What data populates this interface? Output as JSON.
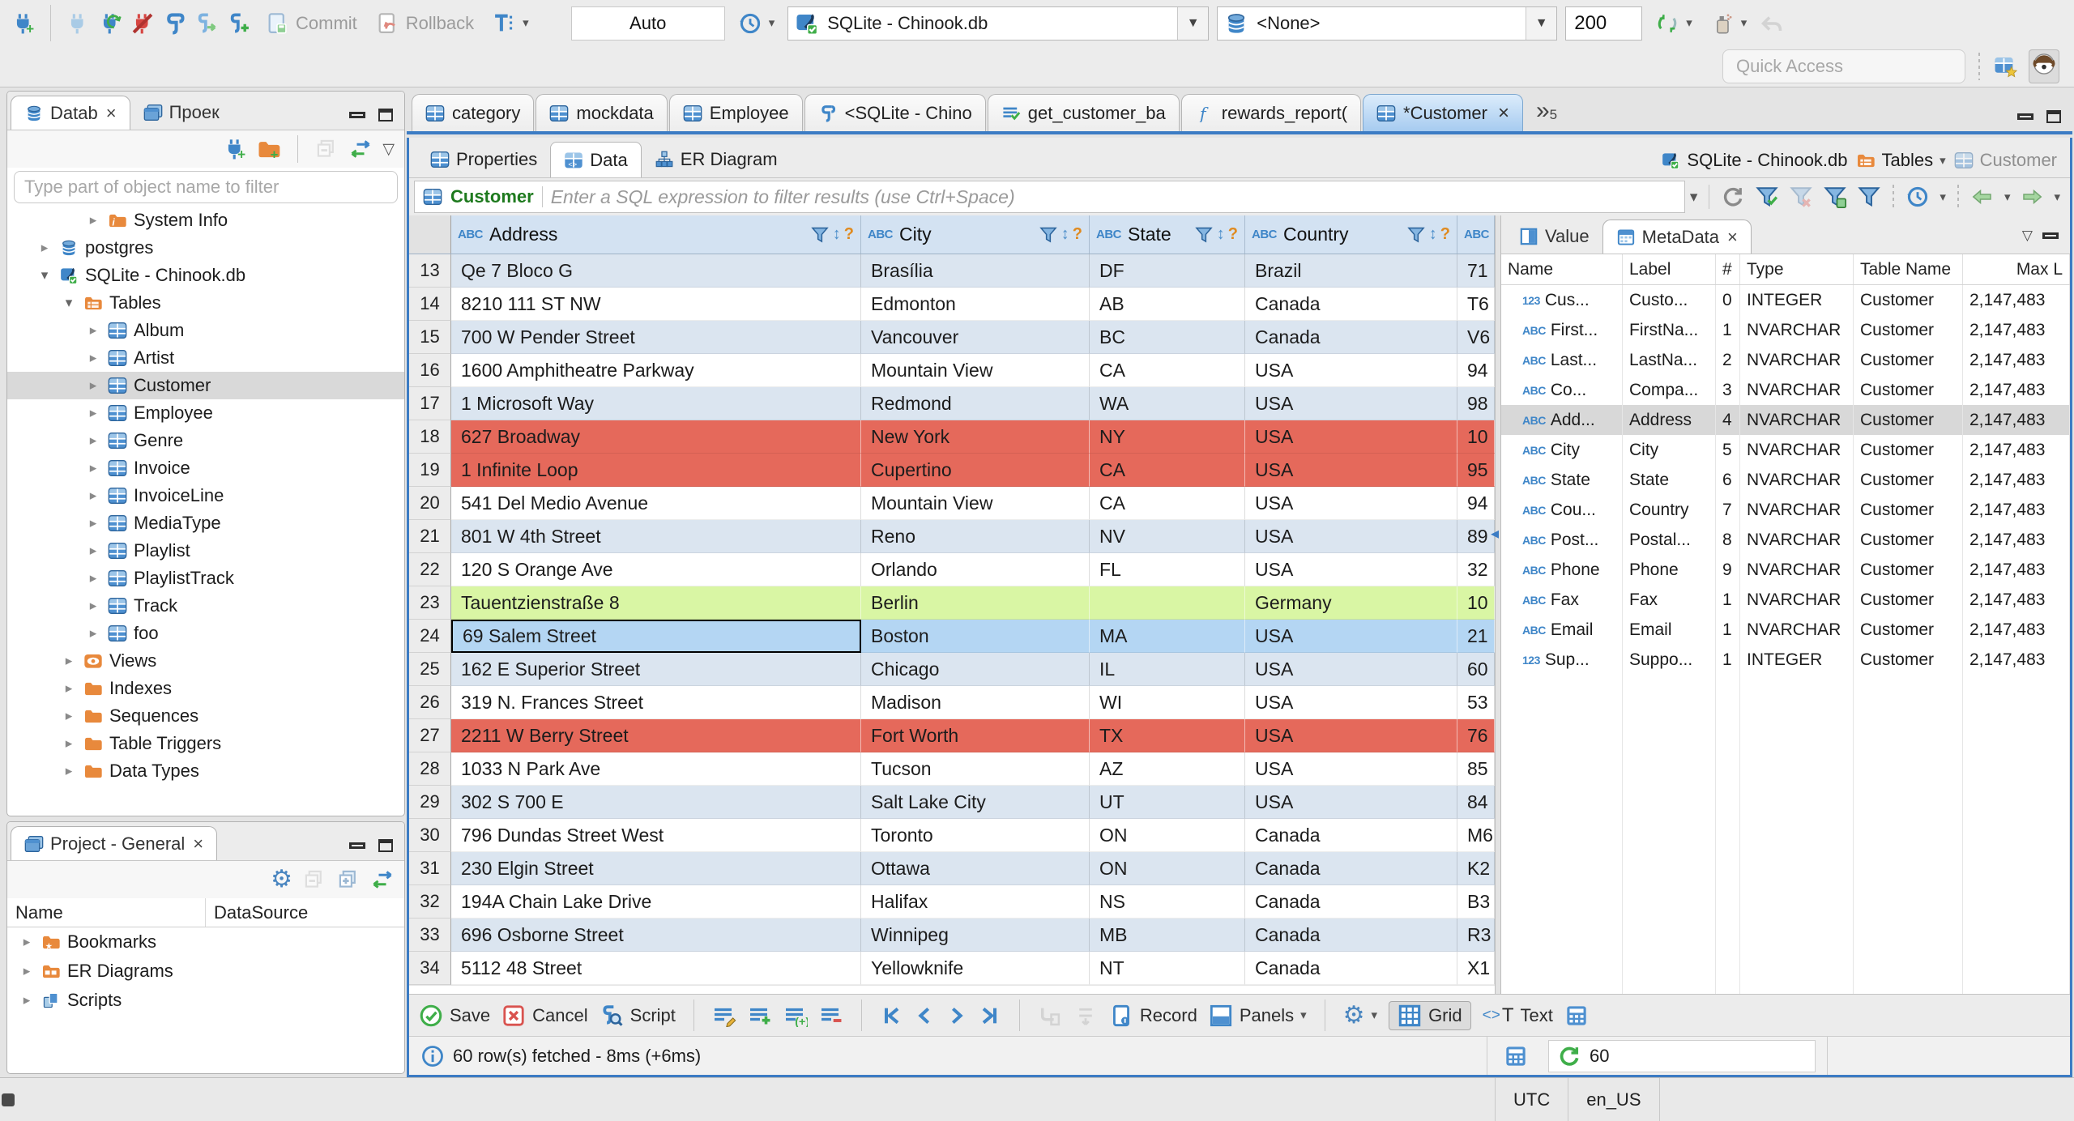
{
  "topbar": {
    "commit": "Commit",
    "rollback": "Rollback",
    "auto": "Auto",
    "db_combo": "SQLite - Chinook.db",
    "schema_combo": "<None>",
    "fetch_size": "200",
    "quick_access": "Quick Access"
  },
  "nav": {
    "tab_database": "Datab",
    "tab_project": "Проек",
    "filter_placeholder": "Type part of object name to filter",
    "tree": [
      {
        "label": "System Info",
        "icon": "foldInfo",
        "arrow": "r",
        "lvl": 3
      },
      {
        "label": "postgres",
        "icon": "dbCyl",
        "arrow": "r",
        "lvl": 1
      },
      {
        "label": "SQLite - Chinook.db",
        "icon": "sqliteIc",
        "arrow": "d",
        "lvl": 1
      },
      {
        "label": "Tables",
        "icon": "foldTbl",
        "arrow": "d",
        "lvl": 2
      },
      {
        "label": "Album",
        "icon": "tbl",
        "arrow": "r",
        "lvl": 3
      },
      {
        "label": "Artist",
        "icon": "tbl",
        "arrow": "r",
        "lvl": 3
      },
      {
        "label": "Customer",
        "icon": "tbl",
        "arrow": "r",
        "lvl": 3,
        "selected": true
      },
      {
        "label": "Employee",
        "icon": "tbl",
        "arrow": "r",
        "lvl": 3
      },
      {
        "label": "Genre",
        "icon": "tbl",
        "arrow": "r",
        "lvl": 3
      },
      {
        "label": "Invoice",
        "icon": "tbl",
        "arrow": "r",
        "lvl": 3
      },
      {
        "label": "InvoiceLine",
        "icon": "tbl",
        "arrow": "r",
        "lvl": 3
      },
      {
        "label": "MediaType",
        "icon": "tbl",
        "arrow": "r",
        "lvl": 3
      },
      {
        "label": "Playlist",
        "icon": "tbl",
        "arrow": "r",
        "lvl": 3
      },
      {
        "label": "PlaylistTrack",
        "icon": "tbl",
        "arrow": "r",
        "lvl": 3
      },
      {
        "label": "Track",
        "icon": "tbl",
        "arrow": "r",
        "lvl": 3
      },
      {
        "label": "foo",
        "icon": "tbl",
        "arrow": "r",
        "lvl": 3
      },
      {
        "label": "Views",
        "icon": "eye",
        "arrow": "r",
        "lvl": 2
      },
      {
        "label": "Indexes",
        "icon": "fold",
        "arrow": "r",
        "lvl": 2
      },
      {
        "label": "Sequences",
        "icon": "fold",
        "arrow": "r",
        "lvl": 2
      },
      {
        "label": "Table Triggers",
        "icon": "fold",
        "arrow": "r",
        "lvl": 2
      },
      {
        "label": "Data Types",
        "icon": "fold",
        "arrow": "r",
        "lvl": 2
      }
    ]
  },
  "project": {
    "title": "Project - General",
    "col_name": "Name",
    "col_datasource": "DataSource",
    "rows": [
      {
        "label": "Bookmarks",
        "icon": "foldStar"
      },
      {
        "label": "ER Diagrams",
        "icon": "foldEr"
      },
      {
        "label": "Scripts",
        "icon": "scriptsIc"
      }
    ]
  },
  "editor": {
    "tabs": [
      {
        "label": "category",
        "icon": "tbl"
      },
      {
        "label": "mockdata",
        "icon": "tbl"
      },
      {
        "label": "Employee",
        "icon": "tbl"
      },
      {
        "label": "<SQLite - Chino",
        "icon": "scroll"
      },
      {
        "label": "get_customer_ba",
        "icon": "sqlExec"
      },
      {
        "label": "rewards_report(",
        "icon": "fnF"
      },
      {
        "label": "*Customer",
        "icon": "tbl",
        "active": true,
        "close": true
      }
    ],
    "more_count": "5",
    "subtabs": [
      {
        "label": "Properties",
        "icon": "tbl"
      },
      {
        "label": "Data",
        "icon": "tblData",
        "active": true
      },
      {
        "label": "ER Diagram",
        "icon": "erIc"
      }
    ],
    "breadcrumb": {
      "db": "SQLite - Chinook.db",
      "tables": "Tables",
      "table": "Customer"
    }
  },
  "filter": {
    "table": "Customer",
    "placeholder": "Enter a SQL expression to filter results (use Ctrl+Space)"
  },
  "grid": {
    "columns": [
      "Address",
      "City",
      "State",
      "Country"
    ],
    "rows": [
      {
        "n": "13",
        "t": "alt",
        "c": [
          "Qe 7 Bloco G",
          "Brasília",
          "DF",
          "Brazil",
          "71"
        ]
      },
      {
        "n": "14",
        "t": "white",
        "c": [
          "8210 111 ST NW",
          "Edmonton",
          "AB",
          "Canada",
          "T6"
        ]
      },
      {
        "n": "15",
        "t": "alt",
        "c": [
          "700 W Pender Street",
          "Vancouver",
          "BC",
          "Canada",
          "V6"
        ]
      },
      {
        "n": "16",
        "t": "white",
        "c": [
          "1600 Amphitheatre Parkway",
          "Mountain View",
          "CA",
          "USA",
          "94"
        ]
      },
      {
        "n": "17",
        "t": "alt",
        "c": [
          "1 Microsoft Way",
          "Redmond",
          "WA",
          "USA",
          "98"
        ]
      },
      {
        "n": "18",
        "t": "red",
        "c": [
          "627 Broadway",
          "New York",
          "NY",
          "USA",
          "10"
        ]
      },
      {
        "n": "19",
        "t": "red",
        "c": [
          "1 Infinite Loop",
          "Cupertino",
          "CA",
          "USA",
          "95"
        ]
      },
      {
        "n": "20",
        "t": "white",
        "c": [
          "541 Del Medio Avenue",
          "Mountain View",
          "CA",
          "USA",
          "94"
        ]
      },
      {
        "n": "21",
        "t": "alt",
        "c": [
          "801 W 4th Street",
          "Reno",
          "NV",
          "USA",
          "89"
        ]
      },
      {
        "n": "22",
        "t": "white",
        "c": [
          "120 S Orange Ave",
          "Orlando",
          "FL",
          "USA",
          "32"
        ]
      },
      {
        "n": "23",
        "t": "green",
        "c": [
          "Tauentzienstraße 8",
          "Berlin",
          "",
          "Germany",
          "10"
        ]
      },
      {
        "n": "24",
        "t": "sel",
        "c": [
          "69 Salem Street",
          "Boston",
          "MA",
          "USA",
          "21"
        ]
      },
      {
        "n": "25",
        "t": "alt",
        "c": [
          "162 E Superior Street",
          "Chicago",
          "IL",
          "USA",
          "60"
        ]
      },
      {
        "n": "26",
        "t": "white",
        "c": [
          "319 N. Frances Street",
          "Madison",
          "WI",
          "USA",
          "53"
        ]
      },
      {
        "n": "27",
        "t": "red",
        "c": [
          "2211 W Berry Street",
          "Fort Worth",
          "TX",
          "USA",
          "76"
        ]
      },
      {
        "n": "28",
        "t": "white",
        "c": [
          "1033 N Park Ave",
          "Tucson",
          "AZ",
          "USA",
          "85"
        ]
      },
      {
        "n": "29",
        "t": "alt",
        "c": [
          "302 S 700 E",
          "Salt Lake City",
          "UT",
          "USA",
          "84"
        ]
      },
      {
        "n": "30",
        "t": "white",
        "c": [
          "796 Dundas Street West",
          "Toronto",
          "ON",
          "Canada",
          "M6"
        ]
      },
      {
        "n": "31",
        "t": "alt",
        "c": [
          "230 Elgin Street",
          "Ottawa",
          "ON",
          "Canada",
          "K2"
        ]
      },
      {
        "n": "32",
        "t": "white",
        "c": [
          "194A Chain Lake Drive",
          "Halifax",
          "NS",
          "Canada",
          "B3"
        ]
      },
      {
        "n": "33",
        "t": "alt",
        "c": [
          "696 Osborne Street",
          "Winnipeg",
          "MB",
          "Canada",
          "R3"
        ]
      },
      {
        "n": "34",
        "t": "white",
        "c": [
          "5112 48 Street",
          "Yellowknife",
          "NT",
          "Canada",
          "X1"
        ]
      }
    ]
  },
  "meta": {
    "tab_value": "Value",
    "tab_meta": "MetaData",
    "columns": [
      "Name",
      "Label",
      "#",
      "Type",
      "Table Name",
      "Max L"
    ],
    "rows": [
      {
        "i": "123",
        "n": "Cus...",
        "l": "Custo...",
        "h": "0",
        "ty": "INTEGER",
        "tb": "Customer",
        "m": "2,147,483"
      },
      {
        "i": "ABC",
        "n": "First...",
        "l": "FirstNa...",
        "h": "1",
        "ty": "NVARCHAR",
        "tb": "Customer",
        "m": "2,147,483"
      },
      {
        "i": "ABC",
        "n": "Last...",
        "l": "LastNa...",
        "h": "2",
        "ty": "NVARCHAR",
        "tb": "Customer",
        "m": "2,147,483"
      },
      {
        "i": "ABC",
        "n": "Co...",
        "l": "Compa...",
        "h": "3",
        "ty": "NVARCHAR",
        "tb": "Customer",
        "m": "2,147,483"
      },
      {
        "i": "ABC",
        "n": "Add...",
        "l": "Address",
        "h": "4",
        "ty": "NVARCHAR",
        "tb": "Customer",
        "m": "2,147,483",
        "sel": true
      },
      {
        "i": "ABC",
        "n": "City",
        "l": "City",
        "h": "5",
        "ty": "NVARCHAR",
        "tb": "Customer",
        "m": "2,147,483"
      },
      {
        "i": "ABC",
        "n": "State",
        "l": "State",
        "h": "6",
        "ty": "NVARCHAR",
        "tb": "Customer",
        "m": "2,147,483"
      },
      {
        "i": "ABC",
        "n": "Cou...",
        "l": "Country",
        "h": "7",
        "ty": "NVARCHAR",
        "tb": "Customer",
        "m": "2,147,483"
      },
      {
        "i": "ABC",
        "n": "Post...",
        "l": "Postal...",
        "h": "8",
        "ty": "NVARCHAR",
        "tb": "Customer",
        "m": "2,147,483"
      },
      {
        "i": "ABC",
        "n": "Phone",
        "l": "Phone",
        "h": "9",
        "ty": "NVARCHAR",
        "tb": "Customer",
        "m": "2,147,483"
      },
      {
        "i": "ABC",
        "n": "Fax",
        "l": "Fax",
        "h": "1",
        "ty": "NVARCHAR",
        "tb": "Customer",
        "m": "2,147,483"
      },
      {
        "i": "ABC",
        "n": "Email",
        "l": "Email",
        "h": "1",
        "ty": "NVARCHAR",
        "tb": "Customer",
        "m": "2,147,483"
      },
      {
        "i": "123",
        "n": "Sup...",
        "l": "Suppo...",
        "h": "1",
        "ty": "INTEGER",
        "tb": "Customer",
        "m": "2,147,483"
      }
    ]
  },
  "rtoolbar": {
    "save": "Save",
    "cancel": "Cancel",
    "script": "Script",
    "record": "Record",
    "panels": "Panels",
    "grid": "Grid",
    "text": "Text"
  },
  "status": {
    "message": "60 row(s) fetched - 8ms (+6ms)",
    "refresh_count": "60"
  },
  "winbar": {
    "tz": "UTC",
    "locale": "en_US"
  }
}
